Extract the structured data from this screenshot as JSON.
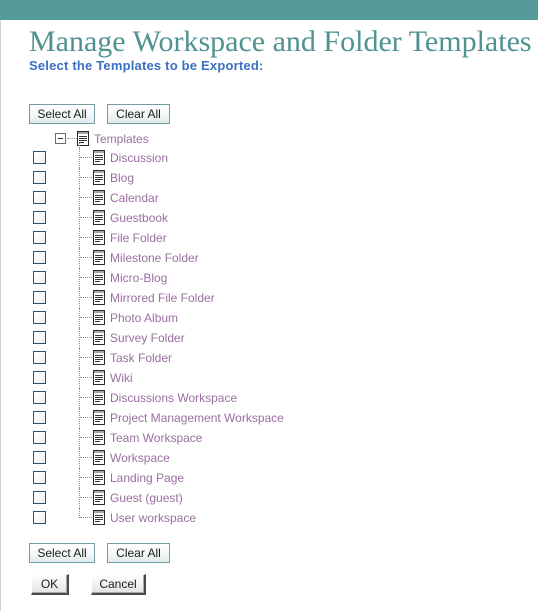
{
  "header": {
    "title": "Manage Workspace and Folder Templates",
    "subtitle": "Select the Templates to be Exported:",
    "banner_color": "#549a99",
    "title_color": "#4f9290",
    "subtitle_color": "#3b6fc4"
  },
  "toolbar_top": {
    "select_all_label": "Select All",
    "clear_all_label": "Clear All"
  },
  "toolbar_bottom": {
    "select_all_label": "Select All",
    "clear_all_label": "Clear All"
  },
  "actions": {
    "ok_label": "OK",
    "cancel_label": "Cancel"
  },
  "tree": {
    "root": {
      "label": "Templates",
      "expander_icon": "minus-box-icon",
      "icon": "document-icon",
      "expanded": true
    },
    "label_color": "#9a6fa0",
    "checkbox_border_color": "#23527c",
    "items": [
      {
        "label": "Discussion",
        "icon": "document-icon",
        "checked": false
      },
      {
        "label": "Blog",
        "icon": "document-icon",
        "checked": false
      },
      {
        "label": "Calendar",
        "icon": "document-icon",
        "checked": false
      },
      {
        "label": "Guestbook",
        "icon": "document-icon",
        "checked": false
      },
      {
        "label": "File Folder",
        "icon": "document-icon",
        "checked": false
      },
      {
        "label": "Milestone Folder",
        "icon": "document-icon",
        "checked": false
      },
      {
        "label": "Micro-Blog",
        "icon": "document-icon",
        "checked": false
      },
      {
        "label": "Mirrored File Folder",
        "icon": "document-icon",
        "checked": false
      },
      {
        "label": "Photo Album",
        "icon": "document-icon",
        "checked": false
      },
      {
        "label": "Survey Folder",
        "icon": "document-icon",
        "checked": false
      },
      {
        "label": "Task Folder",
        "icon": "document-icon",
        "checked": false
      },
      {
        "label": "Wiki",
        "icon": "document-icon",
        "checked": false
      },
      {
        "label": "Discussions Workspace",
        "icon": "document-icon",
        "checked": false
      },
      {
        "label": "Project Management Workspace",
        "icon": "document-icon",
        "checked": false
      },
      {
        "label": "Team Workspace",
        "icon": "document-icon",
        "checked": false
      },
      {
        "label": "Workspace",
        "icon": "document-icon",
        "checked": false
      },
      {
        "label": "Landing Page",
        "icon": "document-icon",
        "checked": false
      },
      {
        "label": "Guest (guest)",
        "icon": "document-icon",
        "checked": false
      },
      {
        "label": "User workspace",
        "icon": "document-icon",
        "checked": false
      }
    ]
  }
}
